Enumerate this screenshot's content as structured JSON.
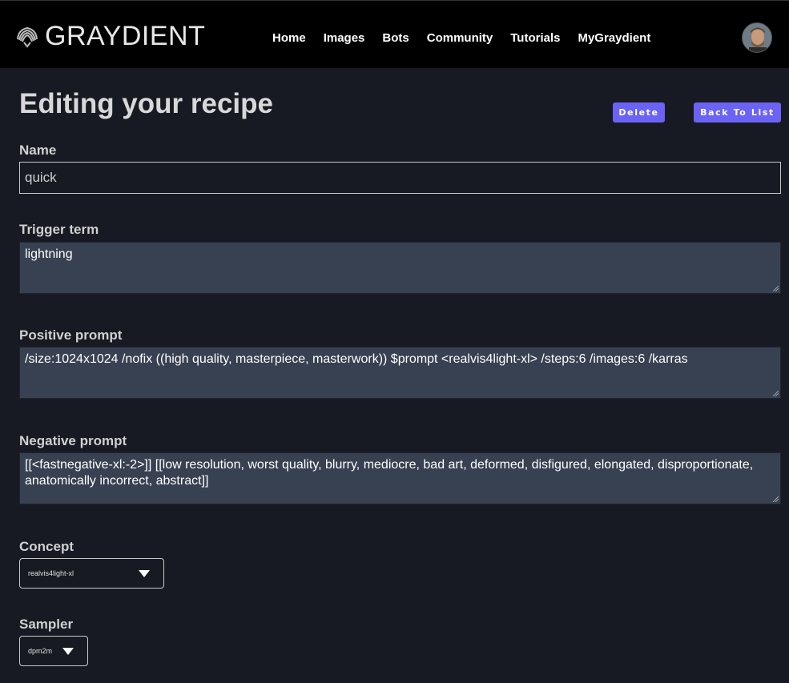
{
  "brand": {
    "name": "GRAYDIENT"
  },
  "nav": {
    "links": [
      {
        "label": "Home"
      },
      {
        "label": "Images"
      },
      {
        "label": "Bots"
      },
      {
        "label": "Community"
      },
      {
        "label": "Tutorials"
      },
      {
        "label": "MyGraydient"
      }
    ]
  },
  "page": {
    "title": "Editing your recipe",
    "delete_label": "Delete",
    "back_label": "Back To List"
  },
  "form": {
    "name": {
      "label": "Name",
      "value": "quick"
    },
    "trigger": {
      "label": "Trigger term",
      "value": "lightning"
    },
    "positive": {
      "label": "Positive prompt",
      "value": "/size:1024x1024 /nofix ((high quality, masterpiece, masterwork))  $prompt  <realvis4light-xl> /steps:6 /images:6 /karras"
    },
    "negative": {
      "label": "Negative prompt",
      "value": "[[<fastnegative-xl:-2>]] [[low resolution, worst quality, blurry, mediocre, bad art, deformed, disfigured, elongated, disproportionate, anatomically incorrect, abstract]]"
    },
    "concept": {
      "label": "Concept",
      "value": "realvis4light-xl"
    },
    "sampler": {
      "label": "Sampler",
      "value": "dpm2m"
    }
  },
  "colors": {
    "background": "#181a23",
    "navbar": "#000000",
    "accent": "#6b63f5",
    "textarea": "#374151"
  },
  "icons": {
    "logo": "shell-logo-icon",
    "dropdown": "caret-down-icon",
    "resize": "resize-grip-icon"
  }
}
